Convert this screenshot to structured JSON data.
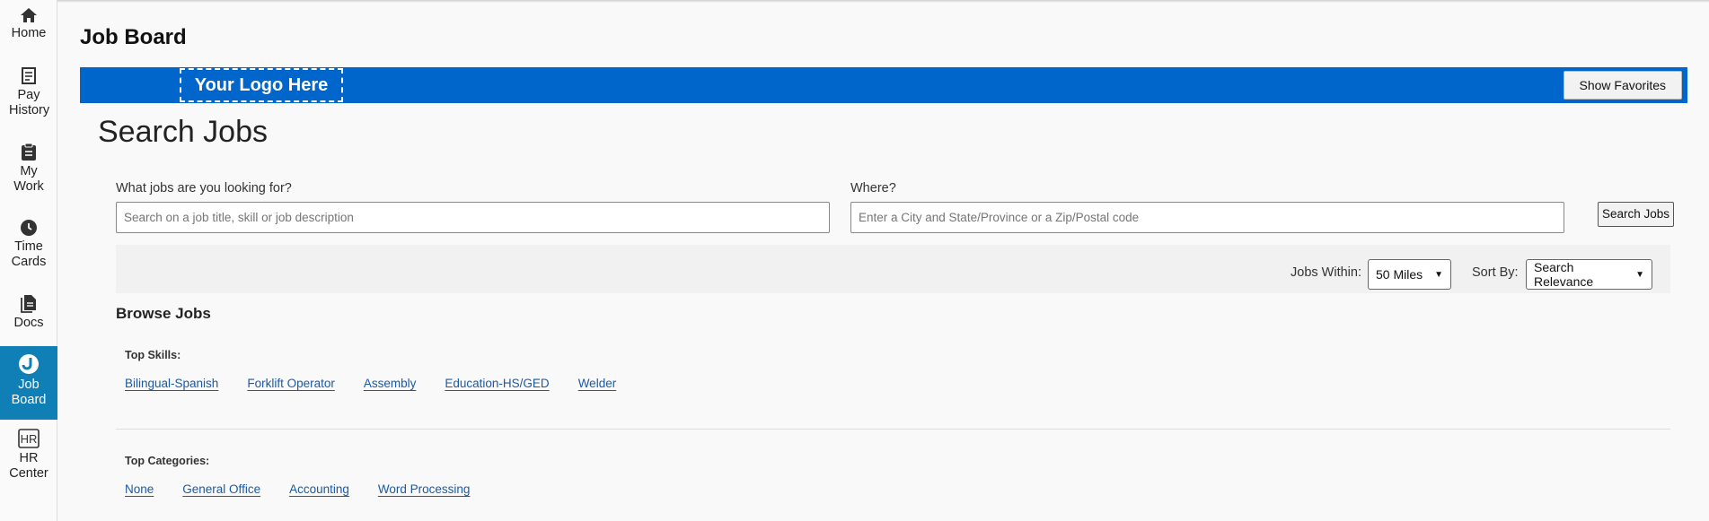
{
  "nav": {
    "items": [
      {
        "label": "Home",
        "icon": "home-icon"
      },
      {
        "label": "Pay History",
        "icon": "receipt-icon"
      },
      {
        "label": "My Work",
        "icon": "clipboard-icon"
      },
      {
        "label": "Time Cards",
        "icon": "clock-icon"
      },
      {
        "label": "Docs",
        "icon": "document-icon"
      },
      {
        "label": "Job Board",
        "icon": "job-board-icon"
      },
      {
        "label": "HR Center",
        "icon": "hr-icon"
      }
    ],
    "active": "Job Board"
  },
  "page": {
    "title": "Job Board"
  },
  "banner": {
    "logo_text": "Your Logo Here",
    "favorites_label": "Show Favorites",
    "color": "#0066cc"
  },
  "search": {
    "title": "Search Jobs",
    "what_label": "What jobs are you looking for?",
    "what_placeholder": "Search on a job title, skill or job description",
    "where_label": "Where?",
    "where_placeholder": "Enter a City and State/Province or a Zip/Postal code",
    "button_label": "Search Jobs"
  },
  "filters": {
    "within_label": "Jobs Within:",
    "within_value": "50 Miles",
    "sort_label": "Sort By:",
    "sort_value": "Search Relevance"
  },
  "browse": {
    "heading": "Browse Jobs",
    "skills_heading": "Top Skills:",
    "skills": [
      "Bilingual-Spanish",
      "Forklift Operator",
      "Assembly",
      "Education-HS/GED",
      "Welder"
    ],
    "categories_heading": "Top Categories:",
    "categories": [
      "None",
      "General Office",
      "Accounting",
      "Word Processing"
    ]
  },
  "colors": {
    "accent": "#0f7fb5",
    "link": "#1a5aa6"
  }
}
